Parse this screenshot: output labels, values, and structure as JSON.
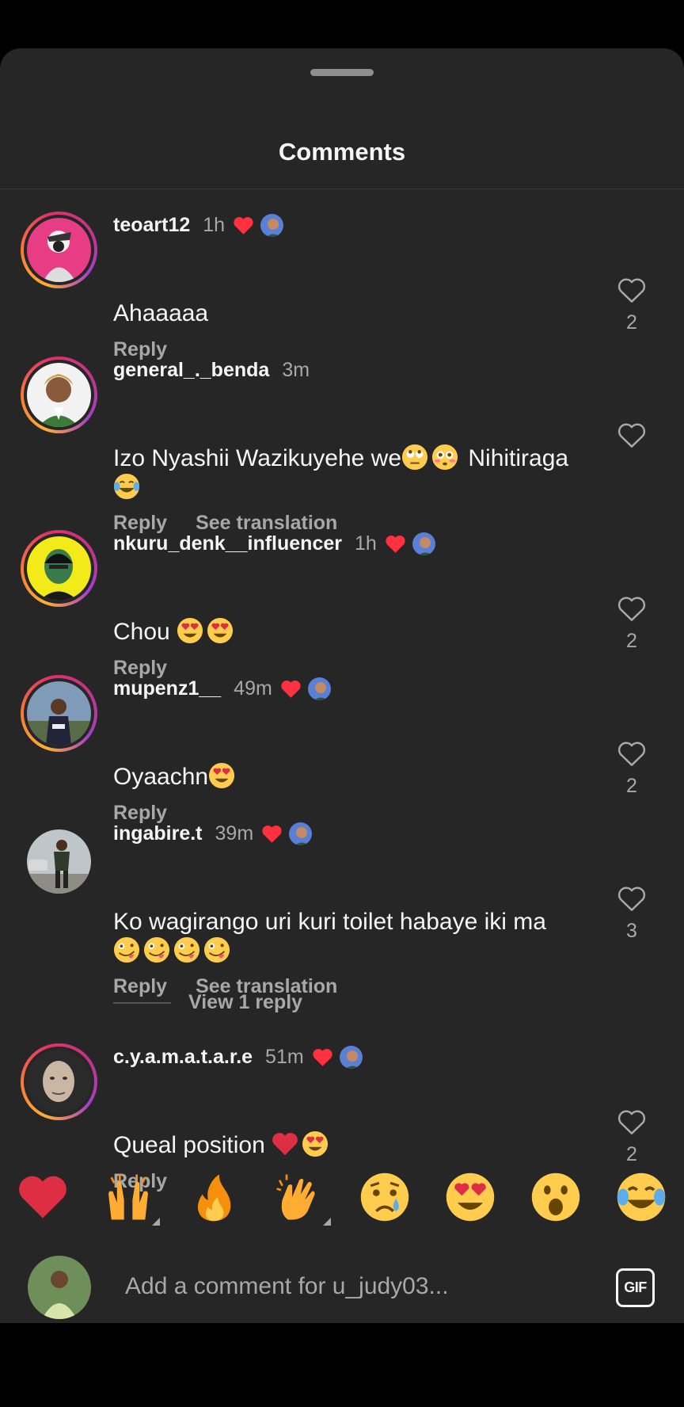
{
  "sheet": {
    "title": "Comments"
  },
  "comments": [
    {
      "username": "teoart12",
      "time": "1h",
      "text": "Ahaaaaa",
      "emojis": [],
      "reply": "Reply",
      "translate": "",
      "likes": "2",
      "liked_by_author": true
    },
    {
      "username": "general_._benda",
      "time": "3m",
      "text": "Izo Nyashii Wazikuyehe we",
      "text2": " Nihitiraga",
      "emojis": [
        "face-with-rolling-eyes",
        "flushed-face",
        "face-with-tears-of-joy"
      ],
      "reply": "Reply",
      "translate": "See translation",
      "likes": "",
      "liked_by_author": false
    },
    {
      "username": "nkuru_denk__influencer",
      "time": "1h",
      "text": "Chou ",
      "emojis": [
        "smiling-face-with-heart-eyes",
        "smiling-face-with-heart-eyes"
      ],
      "reply": "Reply",
      "translate": "",
      "likes": "2",
      "liked_by_author": true
    },
    {
      "username": "mupenz1__",
      "time": "49m",
      "text": "Oyaachn",
      "emojis": [
        "smiling-face-with-heart-eyes"
      ],
      "reply": "Reply",
      "translate": "",
      "likes": "2",
      "liked_by_author": true
    },
    {
      "username": "ingabire.t",
      "time": "39m",
      "text": "Ko wagirango uri kuri toilet habaye iki ma",
      "emojis": [
        "zany-face",
        "zany-face",
        "zany-face",
        "zany-face"
      ],
      "reply": "Reply",
      "translate": "See translation",
      "likes": "3",
      "liked_by_author": true,
      "view_replies": "View 1 reply"
    },
    {
      "username": "c.y.a.m.a.t.a.r.e",
      "time": "51m",
      "text": "Queal position ",
      "emojis": [
        "red-heart",
        "smiling-face-with-heart-eyes"
      ],
      "reply": "Reply",
      "translate": "",
      "likes": "2",
      "liked_by_author": true
    }
  ],
  "quick_reactions": [
    "red-heart",
    "raising-hands",
    "fire",
    "clapping-hands",
    "crying-face",
    "smiling-face-with-heart-eyes",
    "face-with-open-mouth",
    "face-with-tears-of-joy"
  ],
  "composer": {
    "placeholder": "Add a comment for u_judy03...",
    "gif_label": "GIF"
  },
  "colors": {
    "sheet_bg": "#262626",
    "text": "#f5f5f5",
    "muted": "#a8a8a8",
    "like_red": "#ff3040"
  }
}
